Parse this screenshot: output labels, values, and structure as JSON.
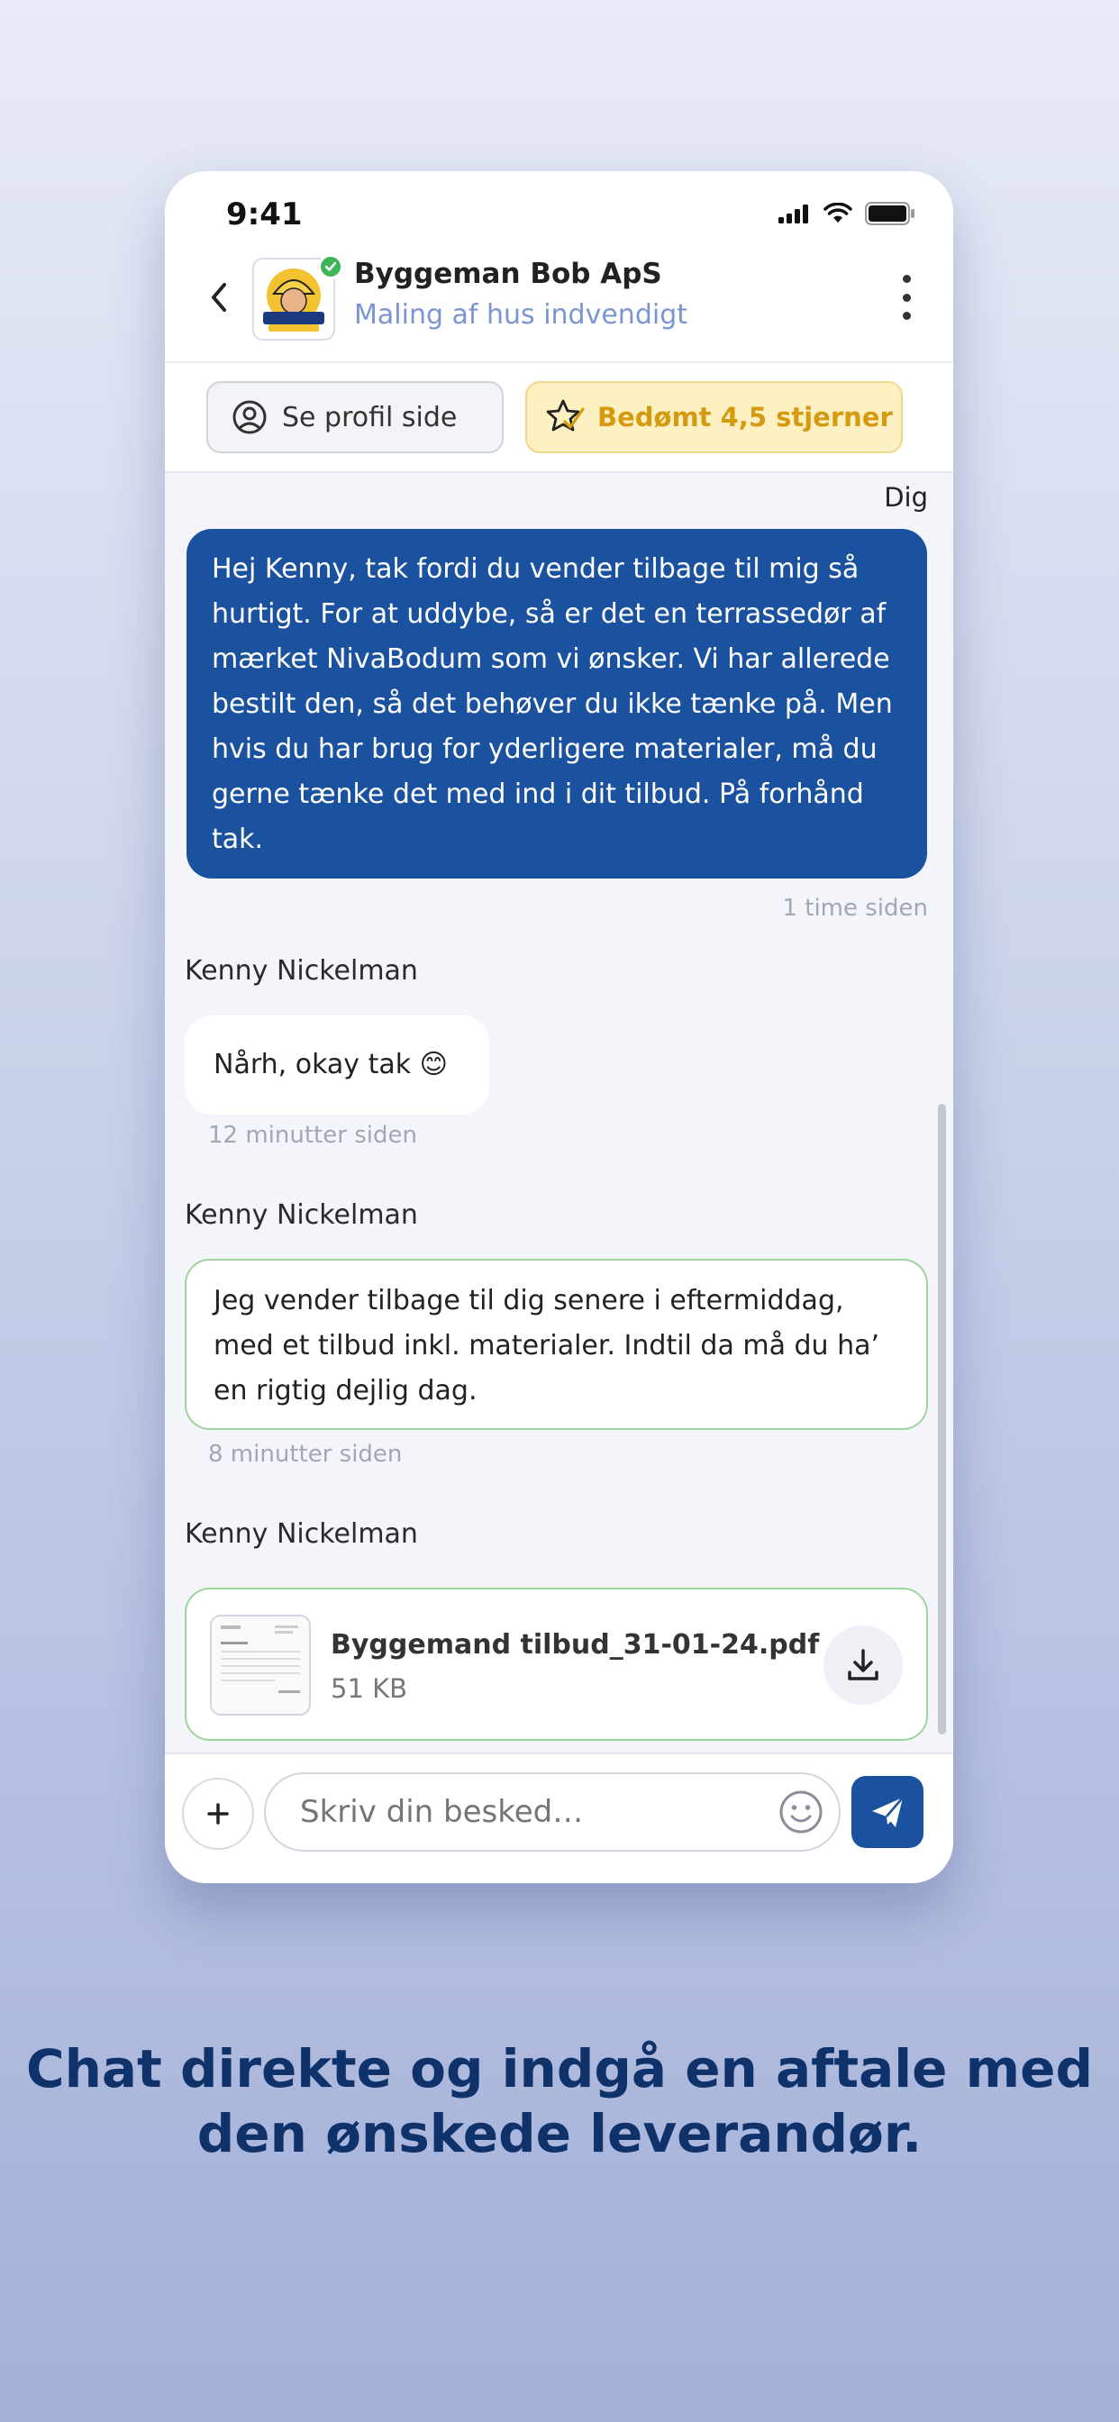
{
  "status": {
    "time": "9:41"
  },
  "header": {
    "company": "Byggeman Bob ApS",
    "subtitle": "Maling af hus indvendigt"
  },
  "actions": {
    "profile_label": "Se profil side",
    "rating_label": "Bedømt 4,5 stjerner"
  },
  "messages": [
    {
      "sender": "Dig",
      "text": "Hej Kenny, tak fordi du vender tilbage til mig så hurtigt. For at uddybe, så er det en terrassedør af mærket NivaBodum som vi ønsker. Vi har allerede bestilt den, så det behøver du ikke tænke på. Men hvis du har brug for yderligere materialer, må du gerne tænke det med ind i dit tilbud. På forhånd tak.",
      "time": "1 time siden"
    },
    {
      "sender": "Kenny Nickelman",
      "text": "Nårh, okay tak 😊",
      "time": "12 minutter siden"
    },
    {
      "sender": "Kenny Nickelman",
      "text": "Jeg vender tilbage til dig senere i eftermiddag, med et tilbud inkl. materialer. Indtil da må du ha’ en rigtig dejlig dag.",
      "time": "8 minutter siden"
    },
    {
      "sender": "Kenny Nickelman",
      "file_name": "Byggemand tilbud_31-01-24.pdf",
      "file_size": "51 KB"
    }
  ],
  "input": {
    "placeholder": "Skriv din besked…"
  },
  "tagline": "Chat direkte og indgå en aftale med den ønskede leverandør.",
  "colors": {
    "primary": "#1b52a0",
    "accent_text": "#7b95d2",
    "rating": "#d59b10",
    "verified": "#3fb55a",
    "tagline": "#10326a"
  }
}
